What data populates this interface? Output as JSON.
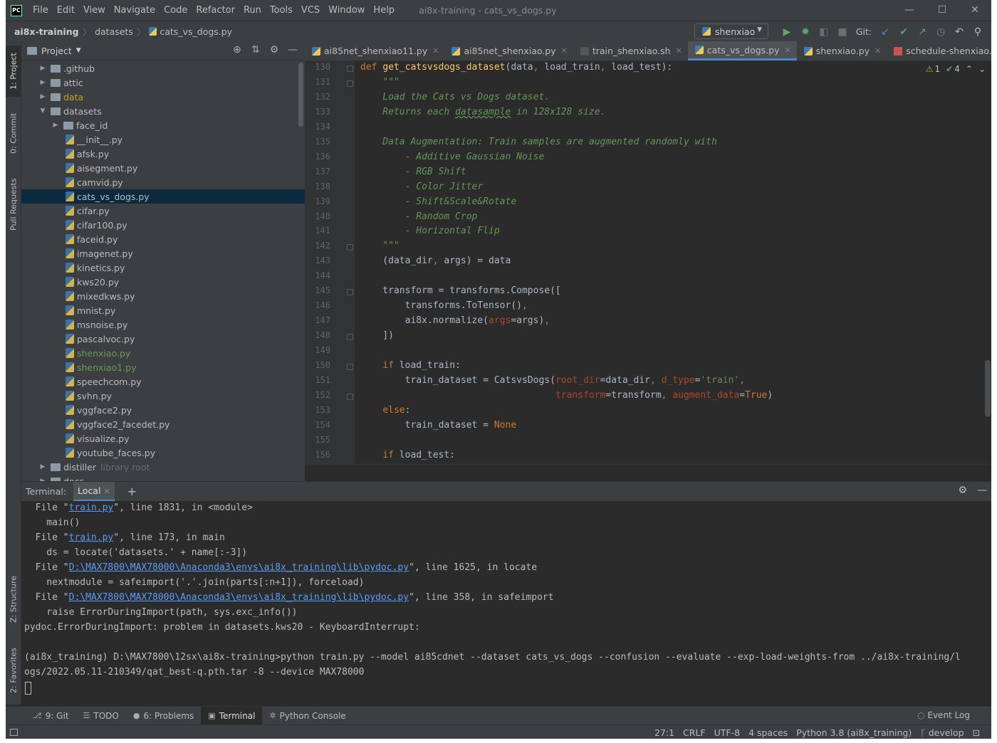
{
  "window": {
    "title": "ai8x-training - cats_vs_dogs.py",
    "logo": "PC"
  },
  "menu": [
    "File",
    "Edit",
    "View",
    "Navigate",
    "Code",
    "Refactor",
    "Run",
    "Tools",
    "VCS",
    "Window",
    "Help"
  ],
  "breadcrumb": [
    "ai8x-training",
    "datasets",
    "cats_vs_dogs.py"
  ],
  "run_config": "shenxiao",
  "git_label": "Git:",
  "left_stripe": [
    "1: Project",
    "0: Commit",
    "Pull Requests",
    "Z: Structure",
    "2: Favorites"
  ],
  "project": {
    "title": "Project",
    "tree": [
      {
        "name": ".github",
        "type": "folder",
        "indent": 1,
        "expanded": false
      },
      {
        "name": "attic",
        "type": "folder",
        "indent": 1,
        "expanded": false
      },
      {
        "name": "data",
        "type": "folder",
        "indent": 1,
        "expanded": false,
        "color": "yellow"
      },
      {
        "name": "datasets",
        "type": "folder",
        "indent": 1,
        "expanded": true
      },
      {
        "name": "face_id",
        "type": "folder",
        "indent": 2,
        "expanded": false
      },
      {
        "name": "__init__.py",
        "type": "py",
        "indent": 3
      },
      {
        "name": "afsk.py",
        "type": "py",
        "indent": 3
      },
      {
        "name": "aisegment.py",
        "type": "py",
        "indent": 3
      },
      {
        "name": "camvid.py",
        "type": "py",
        "indent": 3
      },
      {
        "name": "cats_vs_dogs.py",
        "type": "py",
        "indent": 3,
        "selected": true
      },
      {
        "name": "cifar.py",
        "type": "py",
        "indent": 3
      },
      {
        "name": "cifar100.py",
        "type": "py",
        "indent": 3
      },
      {
        "name": "faceid.py",
        "type": "py",
        "indent": 3
      },
      {
        "name": "imagenet.py",
        "type": "py",
        "indent": 3
      },
      {
        "name": "kinetics.py",
        "type": "py",
        "indent": 3
      },
      {
        "name": "kws20.py",
        "type": "py",
        "indent": 3
      },
      {
        "name": "mixedkws.py",
        "type": "py",
        "indent": 3
      },
      {
        "name": "mnist.py",
        "type": "py",
        "indent": 3
      },
      {
        "name": "msnoise.py",
        "type": "py",
        "indent": 3
      },
      {
        "name": "pascalvoc.py",
        "type": "py",
        "indent": 3
      },
      {
        "name": "shenxiao.py",
        "type": "py",
        "indent": 3,
        "color": "green"
      },
      {
        "name": "shenxiao1.py",
        "type": "py",
        "indent": 3,
        "color": "green"
      },
      {
        "name": "speechcom.py",
        "type": "py",
        "indent": 3
      },
      {
        "name": "svhn.py",
        "type": "py",
        "indent": 3
      },
      {
        "name": "vggface2.py",
        "type": "py",
        "indent": 3
      },
      {
        "name": "vggface2_facedet.py",
        "type": "py",
        "indent": 3
      },
      {
        "name": "visualize.py",
        "type": "py",
        "indent": 3
      },
      {
        "name": "youtube_faces.py",
        "type": "py",
        "indent": 3
      },
      {
        "name": "distiller",
        "type": "folder",
        "indent": 1,
        "expanded": false,
        "suffix": "library root"
      },
      {
        "name": "docs",
        "type": "folder",
        "indent": 1,
        "expanded": false
      }
    ]
  },
  "tabs": [
    {
      "label": "ai85net_shenxiao11.py",
      "icon": "py"
    },
    {
      "label": "ai85net_shenxiao.py",
      "icon": "py"
    },
    {
      "label": "train_shenxiao.sh",
      "icon": "sh"
    },
    {
      "label": "cats_vs_dogs.py",
      "icon": "py",
      "active": true
    },
    {
      "label": "shenxiao.py",
      "icon": "py"
    },
    {
      "label": "schedule-shenxiao.yaml",
      "icon": "yml"
    }
  ],
  "inspections": {
    "warnings": "1",
    "checks": "4"
  },
  "line_numbers": [
    "130",
    "131",
    "132",
    "133",
    "134",
    "135",
    "136",
    "137",
    "138",
    "139",
    "140",
    "141",
    "142",
    "143",
    "144",
    "145",
    "146",
    "147",
    "148",
    "149",
    "150",
    "151",
    "152",
    "153",
    "154",
    "155",
    "156"
  ],
  "code": [
    [
      {
        "t": "def ",
        "c": "kw"
      },
      {
        "t": "get_catsvsdogs_dataset",
        "c": "fn"
      },
      {
        "t": "(data"
      },
      {
        "t": ", ",
        "c": "kw"
      },
      {
        "t": "load_train"
      },
      {
        "t": ", ",
        "c": "kw"
      },
      {
        "t": "load_test):"
      }
    ],
    [
      {
        "t": "    \"\"\"",
        "c": "doc"
      }
    ],
    [
      {
        "t": "    Load the Cats vs Dogs dataset.",
        "c": "doc"
      }
    ],
    [
      {
        "t": "    Returns each ",
        "c": "doc"
      },
      {
        "t": "datasample",
        "c": "doc wv"
      },
      {
        "t": " in 128x128 size.",
        "c": "doc"
      }
    ],
    [
      {
        "t": ""
      }
    ],
    [
      {
        "t": "    Data Augmentation: Train samples are augmented randomly with",
        "c": "doc"
      }
    ],
    [
      {
        "t": "        - Additive Gaussian Noise",
        "c": "doc"
      }
    ],
    [
      {
        "t": "        - RGB Shift",
        "c": "doc"
      }
    ],
    [
      {
        "t": "        - Color Jitter",
        "c": "doc"
      }
    ],
    [
      {
        "t": "        - Shift&Scale&Rotate",
        "c": "doc"
      }
    ],
    [
      {
        "t": "        - Random Crop",
        "c": "doc"
      }
    ],
    [
      {
        "t": "        - Horizontal Flip",
        "c": "doc"
      }
    ],
    [
      {
        "t": "    \"\"\"",
        "c": "doc"
      }
    ],
    [
      {
        "t": "    (data_dir"
      },
      {
        "t": ", ",
        "c": "kw"
      },
      {
        "t": "args) = data"
      }
    ],
    [
      {
        "t": ""
      }
    ],
    [
      {
        "t": "    transform = transforms.Compose(["
      }
    ],
    [
      {
        "t": "        transforms.ToTensor()"
      },
      {
        "t": ",",
        "c": "kw"
      }
    ],
    [
      {
        "t": "        ai8x.normalize("
      },
      {
        "t": "args",
        "c": "pm"
      },
      {
        "t": "=args)"
      },
      {
        "t": ",",
        "c": "kw"
      }
    ],
    [
      {
        "t": "    ])"
      }
    ],
    [
      {
        "t": ""
      }
    ],
    [
      {
        "t": "    "
      },
      {
        "t": "if ",
        "c": "kw"
      },
      {
        "t": "load_train:"
      }
    ],
    [
      {
        "t": "        train_dataset = CatsvsDogs("
      },
      {
        "t": "root_dir",
        "c": "pm"
      },
      {
        "t": "=data_dir"
      },
      {
        "t": ", ",
        "c": "kw"
      },
      {
        "t": "d_type",
        "c": "pm"
      },
      {
        "t": "="
      },
      {
        "t": "'train'",
        "c": "st"
      },
      {
        "t": ",",
        "c": "kw"
      }
    ],
    [
      {
        "t": "                                   "
      },
      {
        "t": "transform",
        "c": "pm"
      },
      {
        "t": "=transform"
      },
      {
        "t": ", ",
        "c": "kw"
      },
      {
        "t": "augment_data",
        "c": "pm"
      },
      {
        "t": "="
      },
      {
        "t": "True",
        "c": "kw"
      },
      {
        "t": ")"
      }
    ],
    [
      {
        "t": "    "
      },
      {
        "t": "else",
        "c": "kw"
      },
      {
        "t": ":"
      }
    ],
    [
      {
        "t": "        train_dataset = "
      },
      {
        "t": "None",
        "c": "kw"
      }
    ],
    [
      {
        "t": ""
      }
    ],
    [
      {
        "t": "    "
      },
      {
        "t": "if ",
        "c": "kw"
      },
      {
        "t": "load_test:"
      }
    ]
  ],
  "terminal": {
    "label": "Terminal:",
    "tab": "Local",
    "lines": [
      [
        {
          "t": "  File \""
        },
        {
          "t": "train.py",
          "c": "lk"
        },
        {
          "t": "\", line 1831, in <module>"
        }
      ],
      [
        {
          "t": "    main()"
        }
      ],
      [
        {
          "t": "  File \""
        },
        {
          "t": "train.py",
          "c": "lk"
        },
        {
          "t": "\", line 173, in main"
        }
      ],
      [
        {
          "t": "    ds = locate('datasets.' + name[:-3])"
        }
      ],
      [
        {
          "t": "  File \""
        },
        {
          "t": "D:\\MAX7800\\MAX78000\\Anaconda3\\envs\\ai8x_training\\lib\\pydoc.py",
          "c": "lk"
        },
        {
          "t": "\", line 1625, in locate"
        }
      ],
      [
        {
          "t": "    nextmodule = safeimport('.'.join(parts[:n+1]), forceload)"
        }
      ],
      [
        {
          "t": "  File \""
        },
        {
          "t": "D:\\MAX7800\\MAX78000\\Anaconda3\\envs\\ai8x_training\\lib\\pydoc.py",
          "c": "lk"
        },
        {
          "t": "\", line 358, in safeimport"
        }
      ],
      [
        {
          "t": "    raise ErrorDuringImport(path, sys.exc_info())"
        }
      ],
      [
        {
          "t": "pydoc.ErrorDuringImport: problem in datasets.kws20 - KeyboardInterrupt:"
        }
      ],
      [
        {
          "t": ""
        }
      ],
      [
        {
          "t": "(ai8x_training) D:\\MAX7800\\12sx\\ai8x-training>python train.py --model ai85cdnet --dataset cats_vs_dogs --confusion --evaluate --exp-load-weights-from ../ai8x-training/l"
        }
      ],
      [
        {
          "t": "ogs/2022.05.11-210349/qat_best-q.pth.tar -8 --device MAX78000"
        }
      ]
    ]
  },
  "bottom_tabs": [
    {
      "label": "9: Git",
      "icon": "git-icon",
      "glyph": "⎇"
    },
    {
      "label": "TODO",
      "icon": "list-icon",
      "glyph": "☰"
    },
    {
      "label": "6: Problems",
      "icon": "warning-icon",
      "glyph": "●"
    },
    {
      "label": "Terminal",
      "icon": "terminal-icon",
      "glyph": "▣",
      "active": true
    },
    {
      "label": "Python Console",
      "icon": "python-icon",
      "glyph": "✲"
    }
  ],
  "event_log": "Event Log",
  "status": {
    "position": "27:1",
    "line_sep": "CRLF",
    "encoding": "UTF-8",
    "indent": "4 spaces",
    "interpreter": "Python 3.8 (ai8x_training)",
    "branch": "develop"
  }
}
